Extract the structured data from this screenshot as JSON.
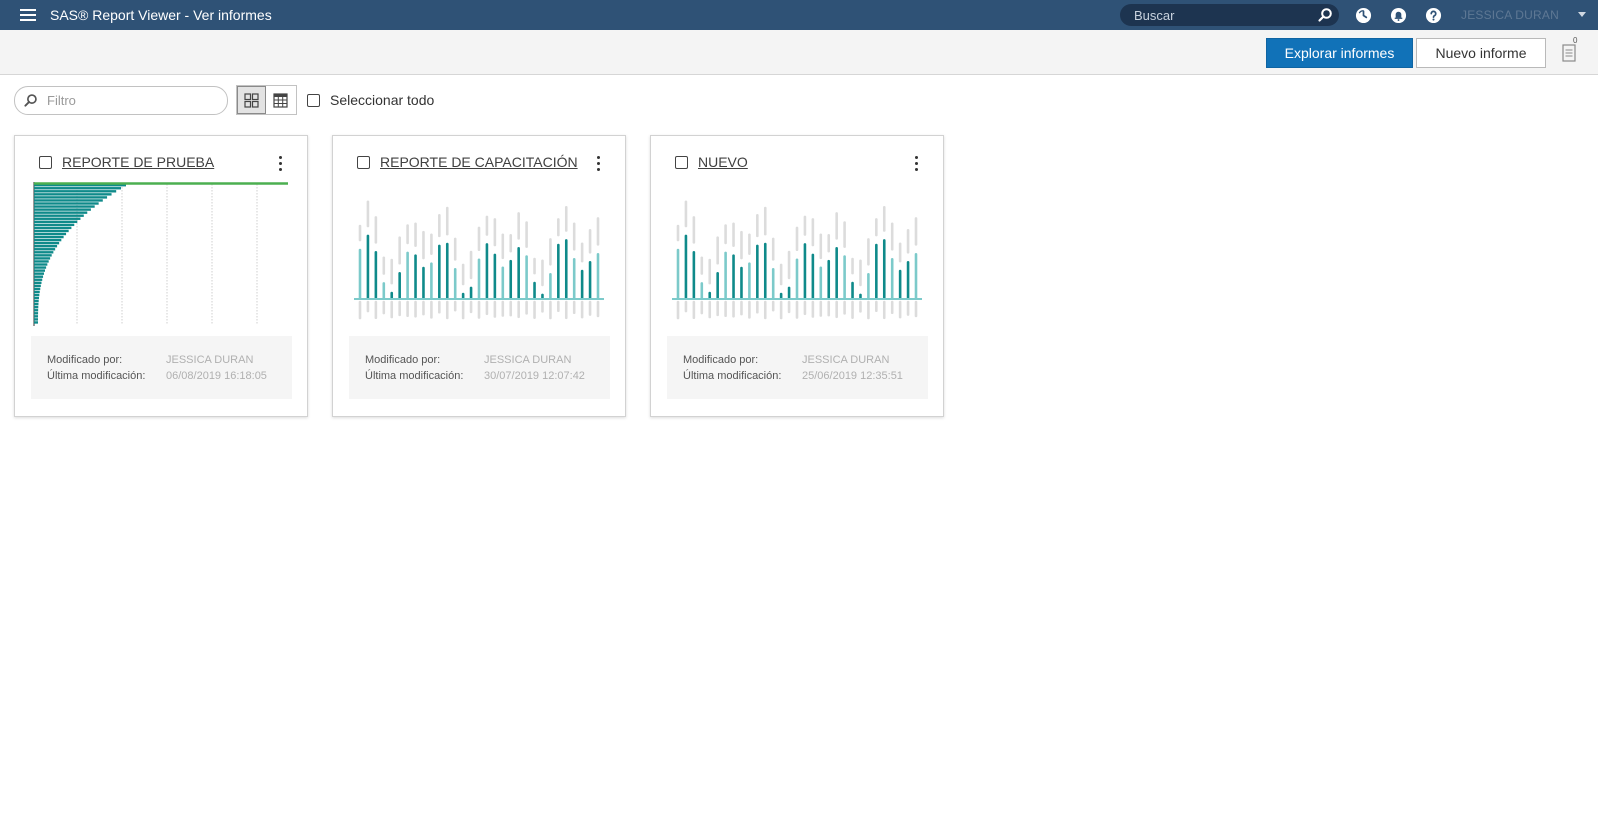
{
  "header": {
    "app_title": "SAS® Report Viewer - Ver informes",
    "search_placeholder": "Buscar",
    "user_name": "JESSICA DURAN",
    "icons": [
      "menu-icon",
      "search-icon",
      "history-icon",
      "notifications-icon",
      "help-icon",
      "chevron-down-icon"
    ]
  },
  "toolbar": {
    "explore_label": "Explorar informes",
    "new_label": "Nuevo informe",
    "notes_count": "0"
  },
  "controls": {
    "filter_placeholder": "Filtro",
    "view_mode": "grid",
    "select_all_label": "Seleccionar todo"
  },
  "cards": [
    {
      "title": "REPORTE DE PRUEBA",
      "thumbnail": "bar-chart-thumbnail",
      "modified_by_label": "Modificado por:",
      "modified_by": "JESSICA DURAN",
      "last_modified_label": "Última modificación:",
      "last_modified": "06/08/2019 16:18:05"
    },
    {
      "title": "REPORTE DE CAPACITACIÓN",
      "thumbnail": "placeholder-thumbnail",
      "modified_by_label": "Modificado por:",
      "modified_by": "JESSICA DURAN",
      "last_modified_label": "Última modificación:",
      "last_modified": "30/07/2019 12:07:42"
    },
    {
      "title": "NUEVO",
      "thumbnail": "placeholder-thumbnail",
      "modified_by_label": "Modificado por:",
      "modified_by": "JESSICA DURAN",
      "last_modified_label": "Última modificación:",
      "last_modified": "25/06/2019 12:35:51"
    }
  ],
  "colors": {
    "header_bg": "#2f5276",
    "primary_button": "#1172b8",
    "teal_dark": "#0f8a8a",
    "teal_light": "#7ccaca",
    "thumb_grey": "#dcdcdc",
    "green_line": "#4caf50"
  }
}
